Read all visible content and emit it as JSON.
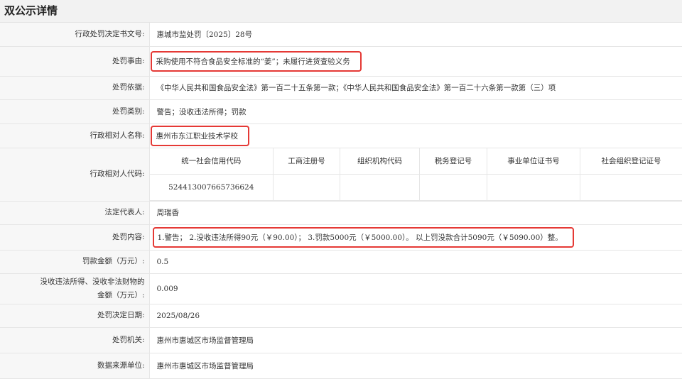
{
  "page_title": "双公示详情",
  "fields": {
    "doc_no": {
      "label": "行政处罚决定书文号:",
      "value": "惠城市监处罚〔2025〕28号"
    },
    "reason": {
      "label": "处罚事由:",
      "value": "采购使用不符合食品安全标准的“姜”；未履行进货查验义务"
    },
    "basis": {
      "label": "处罚依据:",
      "value": "《中华人民共和国食品安全法》第一百二十五条第一款；《中华人民共和国食品安全法》第一百二十六条第一款第（三）项"
    },
    "category": {
      "label": "处罚类别:",
      "value": "警告；没收违法所得；罚款"
    },
    "party_name": {
      "label": "行政相对人名称:",
      "value": "惠州市东江职业技术学校"
    },
    "party_code": {
      "label": "行政相对人代码:",
      "headers": [
        "统一社会信用代码",
        "工商注册号",
        "组织机构代码",
        "税务登记号",
        "事业单位证书号",
        "社会组织登记证号"
      ],
      "values": [
        "524413007665736624",
        "",
        "",
        "",
        "",
        ""
      ]
    },
    "legal_rep": {
      "label": "法定代表人:",
      "value": "周瑞香"
    },
    "content": {
      "label": "处罚内容:",
      "value": "1.警告；  2.没收违法所得90元（￥90.00）；  3.罚款5000元（￥5000.00）。 以上罚没款合计5090元（￥5090.00）整。"
    },
    "fine": {
      "label": "罚款金额（万元）:",
      "value": "0.5"
    },
    "confiscation": {
      "label_line1": "没收违法所得、没收非法财物的",
      "label_line2": "金额（万元）:",
      "value": "0.009"
    },
    "decision_date": {
      "label": "处罚决定日期:",
      "value": "2025/08/26"
    },
    "authority": {
      "label": "处罚机关:",
      "value": "惠州市惠城区市场监督管理局"
    },
    "source": {
      "label": "数据来源单位:",
      "value": "惠州市惠城区市场监督管理局"
    }
  },
  "highlight_color": "#e53935"
}
